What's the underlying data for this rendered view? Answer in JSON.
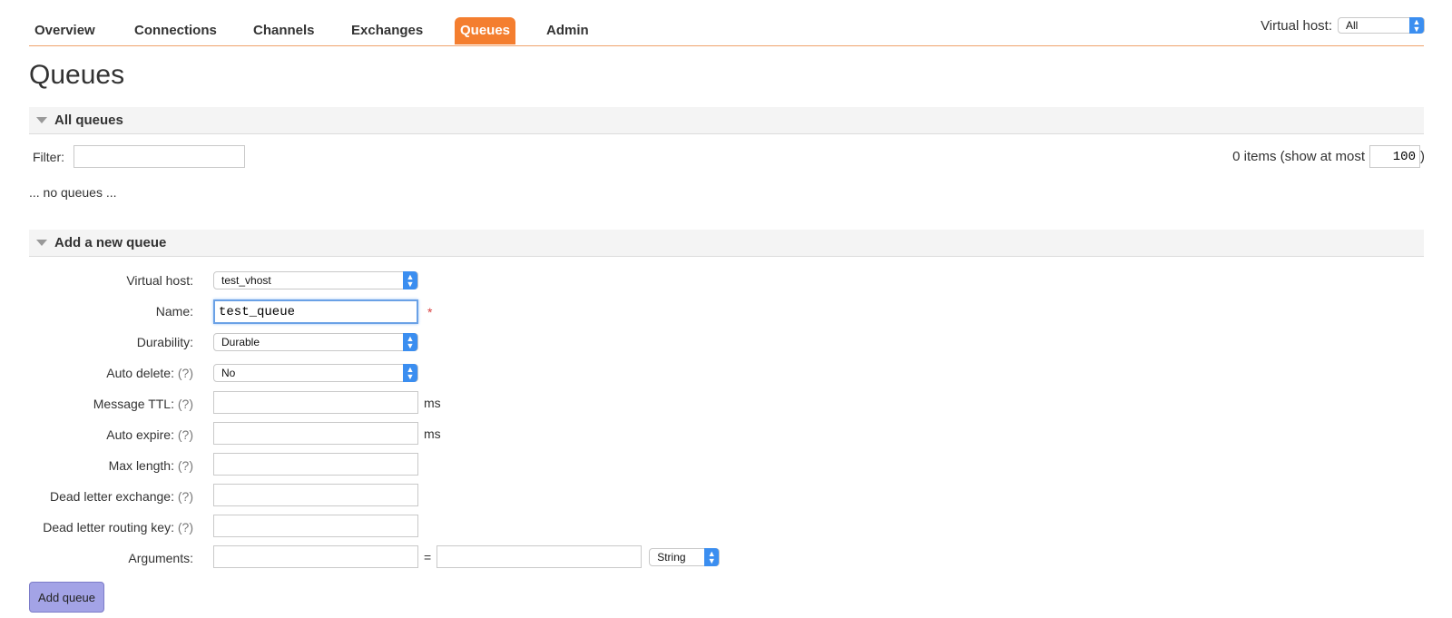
{
  "nav": {
    "tabs": [
      {
        "label": "Overview"
      },
      {
        "label": "Connections"
      },
      {
        "label": "Channels"
      },
      {
        "label": "Exchanges"
      },
      {
        "label": "Queues",
        "active": true
      },
      {
        "label": "Admin"
      }
    ],
    "virtual_host_label": "Virtual host:",
    "virtual_host_value": "All",
    "accent_color": "#f47e2f"
  },
  "page_title": "Queues",
  "all_queues": {
    "title": "All queues",
    "filter_label": "Filter:",
    "filter_value": "",
    "count_text": "0 items (show at most",
    "show_at_most": "100",
    "count_close": ")",
    "empty_text": "... no queues ..."
  },
  "add_queue": {
    "title": "Add a new queue",
    "virtual_host_label": "Virtual host:",
    "virtual_host_value": "test_vhost",
    "name_label": "Name:",
    "name_value": "test_queue",
    "required_mark": "*",
    "durability_label": "Durability:",
    "durability_value": "Durable",
    "auto_delete_label": "Auto delete:",
    "auto_delete_value": "No",
    "help_mark": "(?)",
    "message_ttl_label": "Message TTL:",
    "auto_expire_label": "Auto expire:",
    "ms_unit": "ms",
    "max_length_label": "Max length:",
    "dead_letter_exchange_label": "Dead letter exchange:",
    "dead_letter_routing_key_label": "Dead letter routing key:",
    "arguments_label": "Arguments:",
    "arguments_eq": "=",
    "arguments_type": "String",
    "submit_label": "Add queue"
  }
}
